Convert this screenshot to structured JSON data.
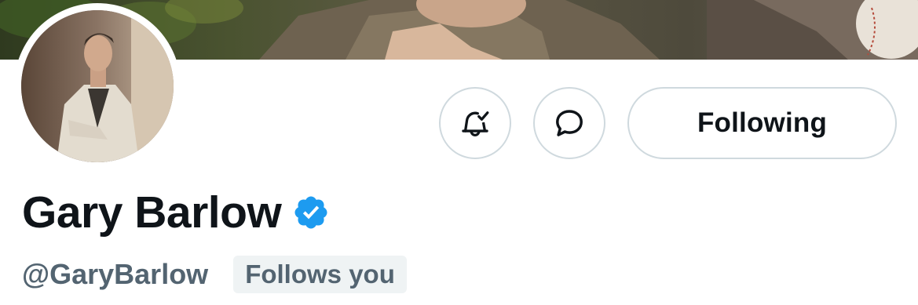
{
  "profile": {
    "display_name": "Gary Barlow",
    "handle": "@GaryBarlow",
    "follows_you_label": "Follows you",
    "verified": true
  },
  "actions": {
    "notifications_icon": "bell-check-icon",
    "message_icon": "message-bubble-icon",
    "following_label": "Following"
  },
  "colors": {
    "text_primary": "#0f1419",
    "text_secondary": "#536471",
    "verified_blue": "#1d9bf0",
    "border": "#cfd9de",
    "badge_bg": "#eff3f4"
  }
}
